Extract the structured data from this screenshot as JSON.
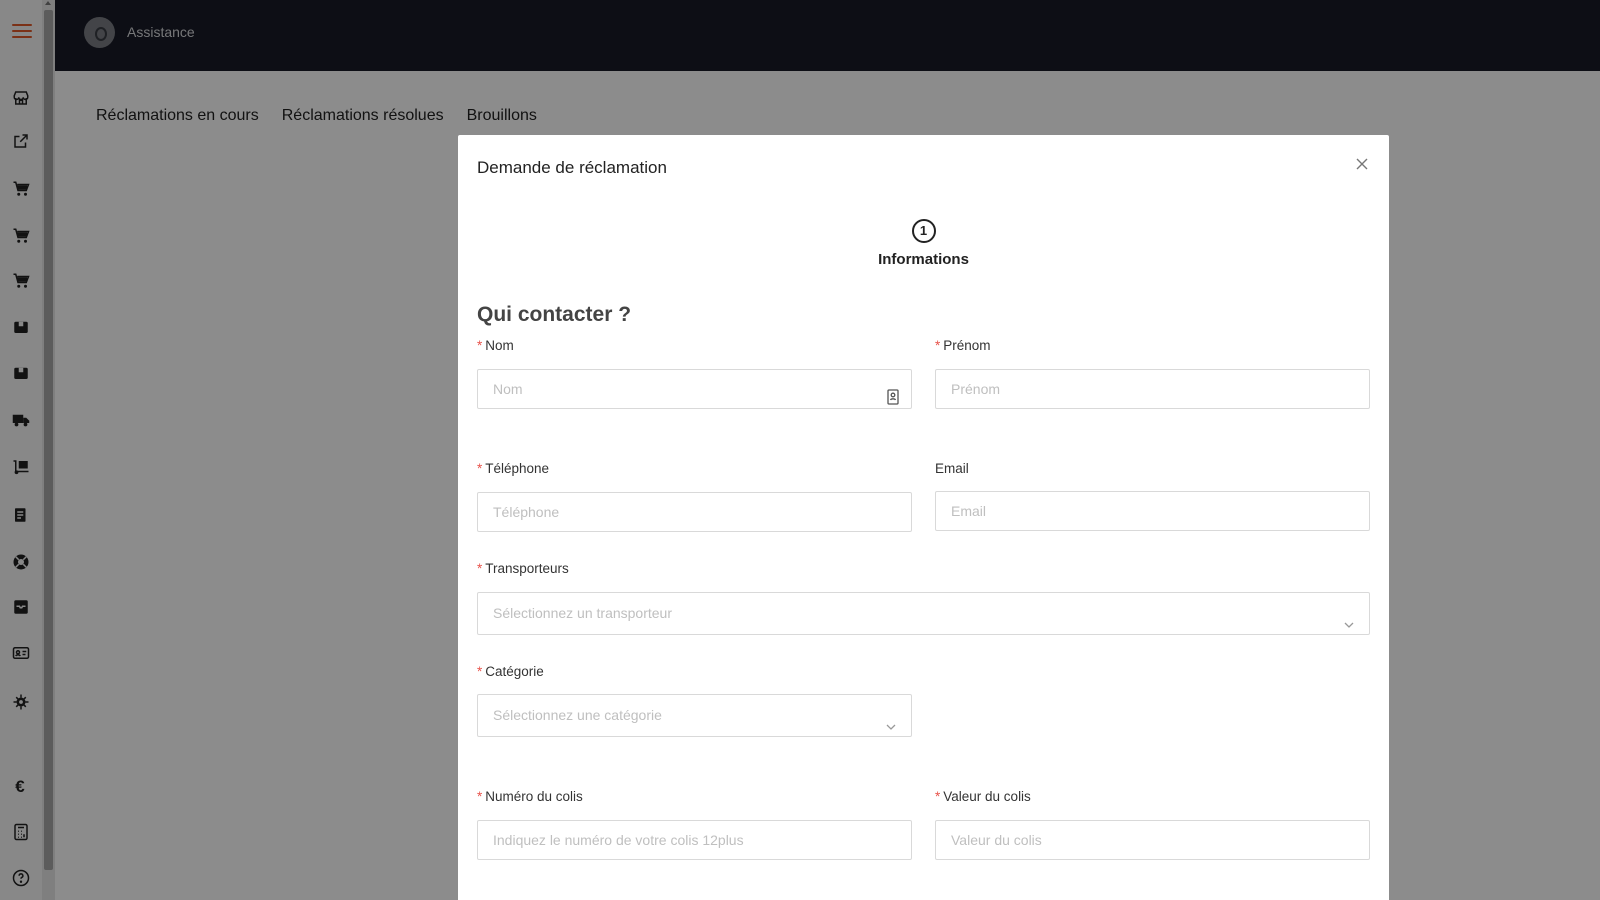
{
  "topbar": {
    "title": "Assistance"
  },
  "tabs": [
    {
      "label": "Réclamations en cours"
    },
    {
      "label": "Réclamations résolues"
    },
    {
      "label": "Brouillons"
    }
  ],
  "sidebar": {
    "icons": [
      "store-icon",
      "external-link-icon",
      "cart-icon",
      "cart-icon",
      "cart-icon",
      "box-icon",
      "box-icon",
      "truck-icon",
      "dolly-icon",
      "invoice-icon",
      "support-icon",
      "inbox-icon",
      "id-card-icon",
      "gear-icon",
      "euro-icon",
      "calculator-icon",
      "help-icon"
    ]
  },
  "modal": {
    "title": "Demande de réclamation",
    "step": {
      "number": "1",
      "label": "Informations"
    },
    "section_title": "Qui contacter ?",
    "fields": {
      "nom": {
        "label": "Nom",
        "required": true,
        "placeholder": "Nom"
      },
      "prenom": {
        "label": "Prénom",
        "required": true,
        "placeholder": "Prénom"
      },
      "telephone": {
        "label": "Téléphone",
        "required": true,
        "placeholder": "Téléphone"
      },
      "email": {
        "label": "Email",
        "required": false,
        "placeholder": "Email"
      },
      "transporteurs": {
        "label": "Transporteurs",
        "required": true,
        "placeholder": "Sélectionnez un transporteur"
      },
      "categorie": {
        "label": "Catégorie",
        "required": true,
        "placeholder": "Sélectionnez une catégorie"
      },
      "numero_colis": {
        "label": "Numéro du colis",
        "required": true,
        "placeholder": "Indiquez le numéro de votre colis 12plus"
      },
      "valeur_colis": {
        "label": "Valeur du colis",
        "required": true,
        "placeholder": "Valeur du colis"
      }
    }
  },
  "colors": {
    "accent": "#e05a2b",
    "topbar": "#191b27",
    "required": "#e8524a"
  }
}
